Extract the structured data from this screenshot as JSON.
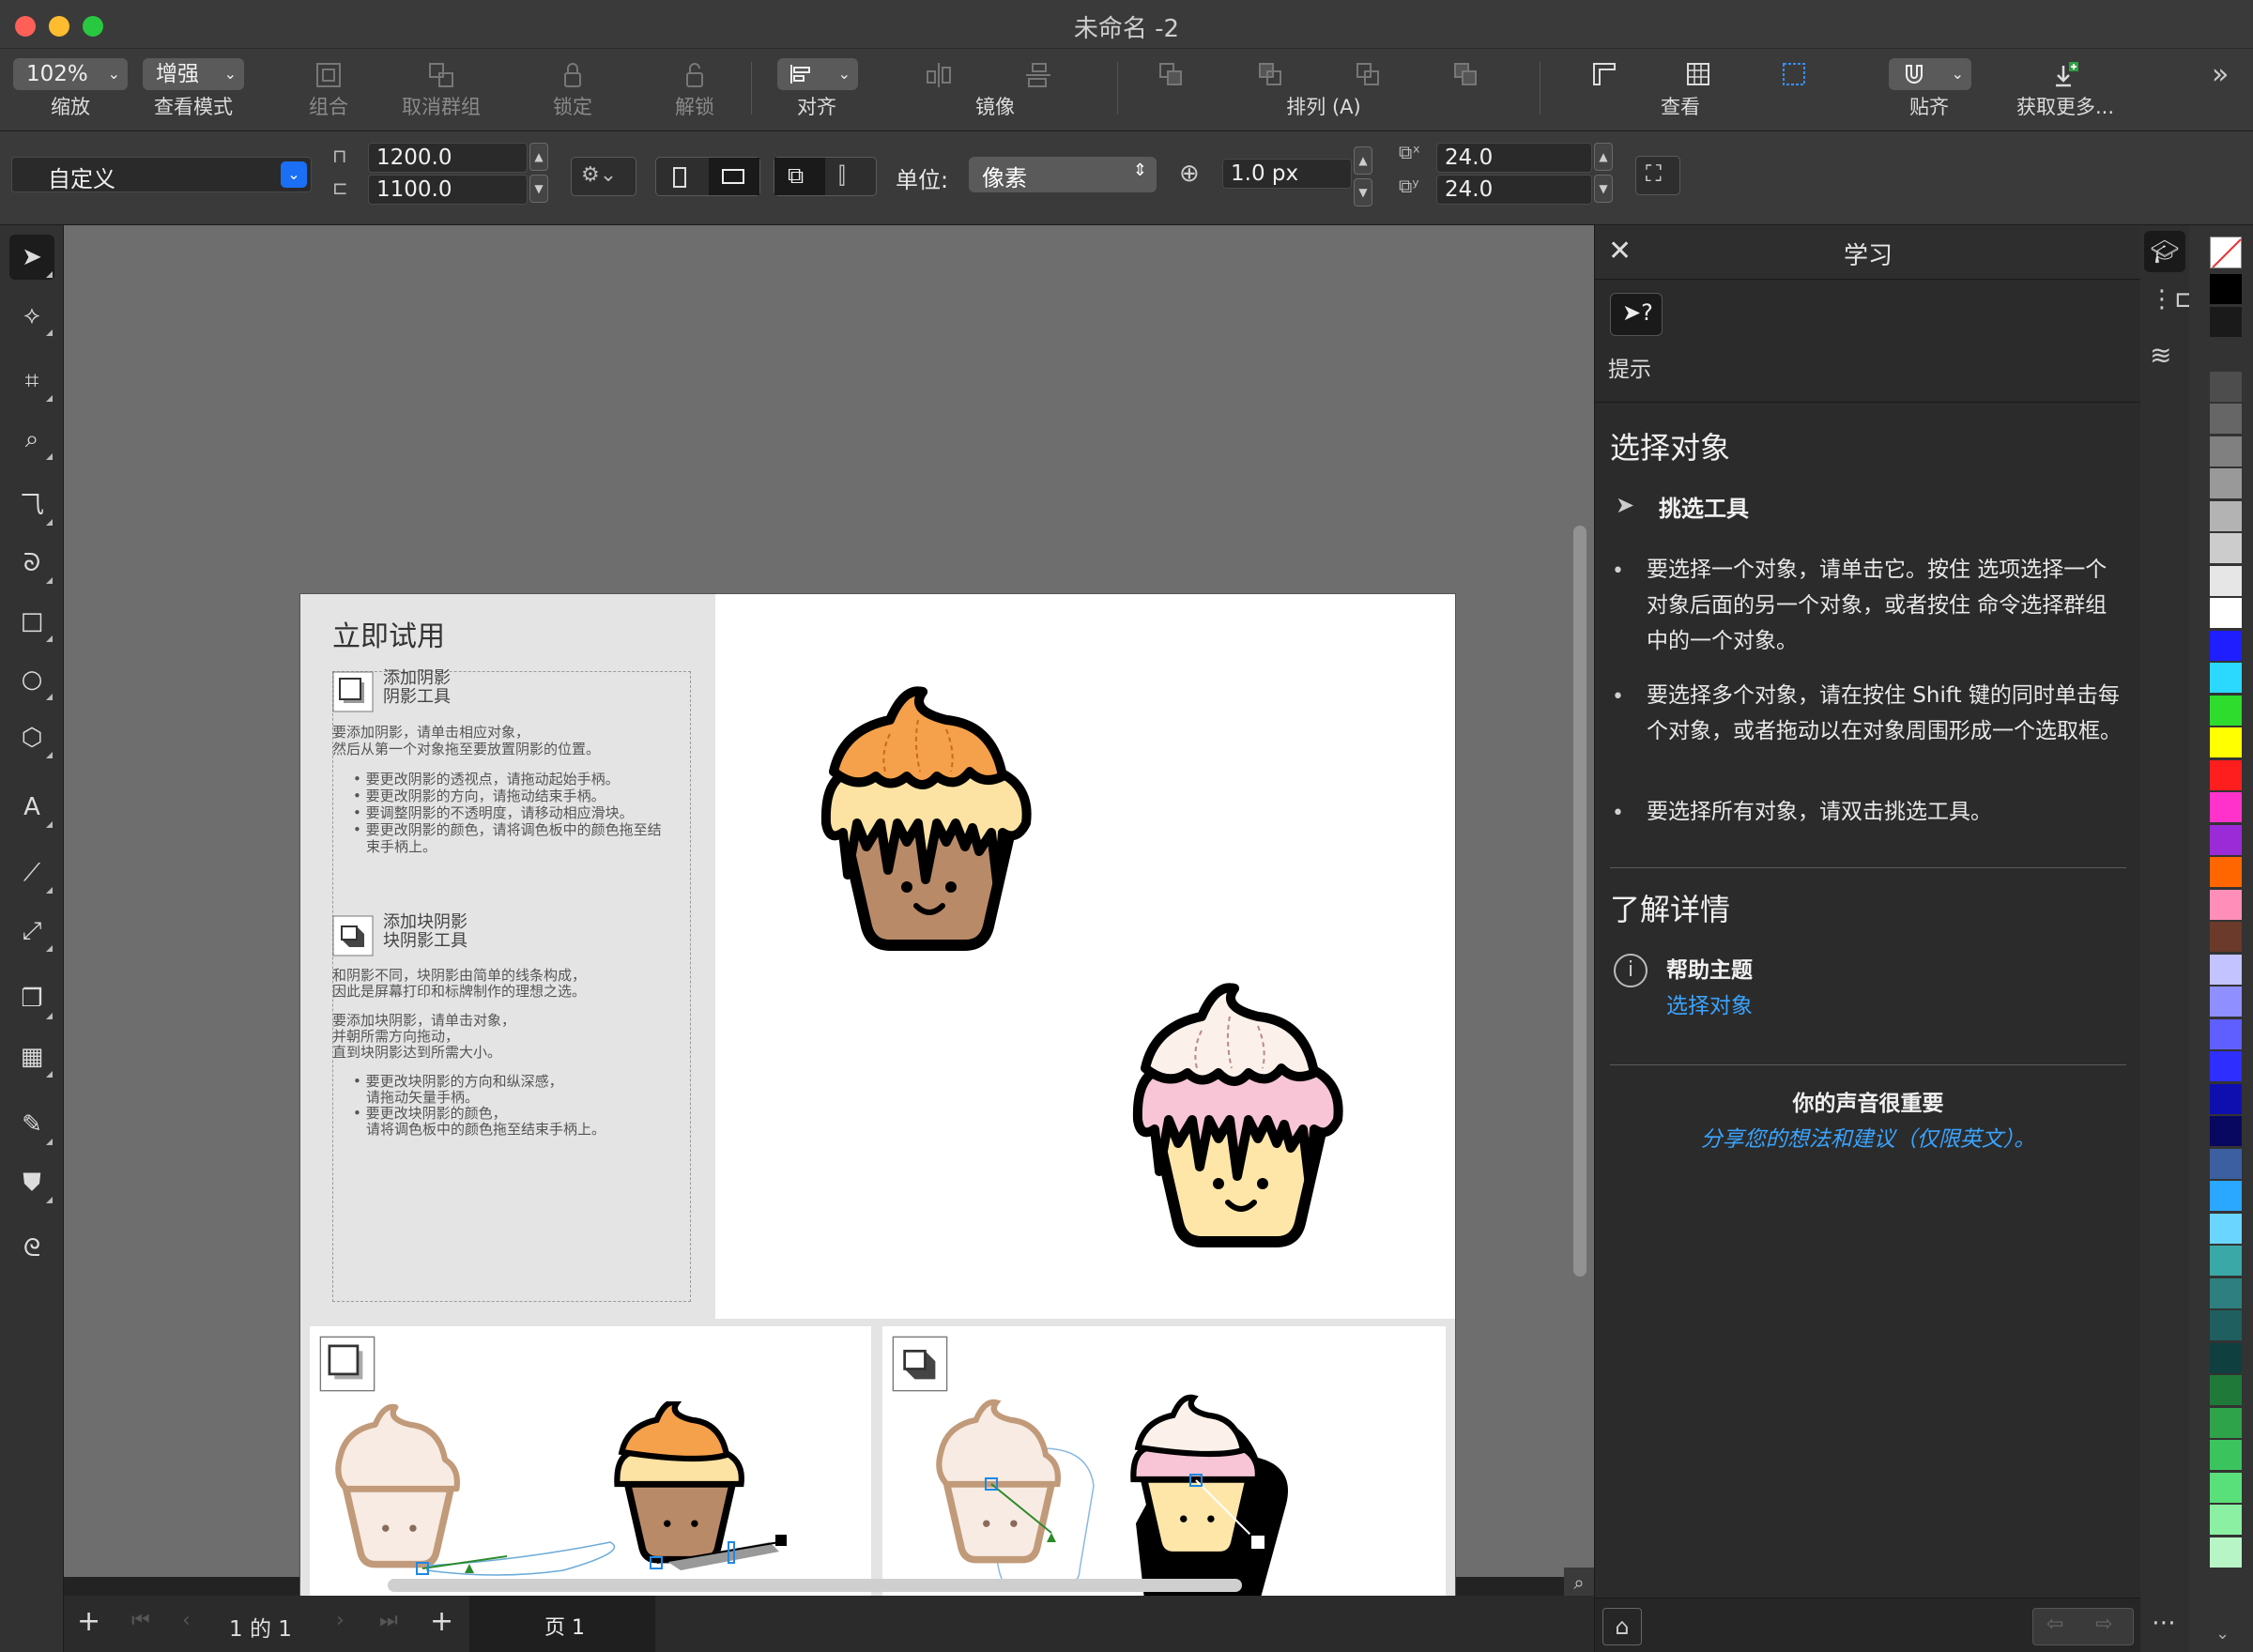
{
  "window": {
    "title": "未命名 -2"
  },
  "toolbar": {
    "zoom_value": "102%",
    "zoom_label": "缩放",
    "view_mode_value": "增强",
    "view_mode_label": "查看模式",
    "group_label": "组合",
    "ungroup_label": "取消群组",
    "lock_label": "锁定",
    "unlock_label": "解锁",
    "align_label": "对齐",
    "mirror_label": "镜像",
    "arrange_label": "排列 (A)",
    "view_label": "查看",
    "snap_label": "贴齐",
    "get_more_label": "获取更多..."
  },
  "propbar": {
    "preset": "自定义",
    "width": "1200.0",
    "height": "1100.0",
    "unit_label": "单位:",
    "unit_value": "像素",
    "nudge": "1.0 px",
    "dup_x": "24.0",
    "dup_y": "24.0"
  },
  "page_content": {
    "try_title": "立即试用",
    "shadow_title": "添加阴影",
    "shadow_sub": "阴影工具",
    "shadow_intro_1": "要添加阴影，请单击相应对象，",
    "shadow_intro_2": "然后从第一个对象拖至要放置阴影的位置。",
    "shadow_b1": "要更改阴影的透视点，请拖动起始手柄。",
    "shadow_b2": "要更改阴影的方向，请拖动结束手柄。",
    "shadow_b3": "要调整阴影的不透明度，请移动相应滑块。",
    "shadow_b4a": "要更改阴影的颜色，请将调色板中的颜色拖至结",
    "shadow_b4b": "束手柄上。",
    "block_title": "添加块阴影",
    "block_sub": "块阴影工具",
    "block_intro_1": "和阴影不同，块阴影由简单的线条构成，",
    "block_intro_2": "因此是屏幕打印和标牌制作的理想之选。",
    "block_how_1": "要添加块阴影，请单击对象，",
    "block_how_2": "并朝所需方向拖动，",
    "block_how_3": "直到块阴影达到所需大小。",
    "block_b1a": "要更改块阴影的方向和纵深感，",
    "block_b1b": "请拖动矢量手柄。",
    "block_b2a": "要更改块阴影的颜色，",
    "block_b2b": "请将调色板中的颜色拖至结束手柄上。"
  },
  "navbar": {
    "page_count": "1 的 1",
    "page_tab": "页 1"
  },
  "learn_panel": {
    "title": "学习",
    "hint_label": "提示",
    "section_title": "选择对象",
    "tool_name": "挑选工具",
    "bullet1": "要选择一个对象，请单击它。按住 选项选择一个对象后面的另一个对象，或者按住 命令选择群组中的一个对象。",
    "bullet2": "要选择多个对象，请在按住 Shift 键的同时单击每个对象，或者拖动以在对象周围形成一个选取框。",
    "bullet3": "要选择所有对象，请双击挑选工具。",
    "learn_more": "了解详情",
    "help_topics": "帮助主题",
    "help_link": "选择对象",
    "feedback_title": "你的声音很重要",
    "feedback_link": "分享您的想法和建议（仅限英文）。"
  },
  "palette_colors": [
    "#000000",
    "#1a1a1a",
    "#333333",
    "#4d4d4d",
    "#666666",
    "#808080",
    "#999999",
    "#b3b3b3",
    "#cccccc",
    "#e6e6e6",
    "#ffffff",
    "#1e1eff",
    "#2bd9ff",
    "#2ddc2d",
    "#ffff00",
    "#ff1e1e",
    "#ff33cc",
    "#9b2bd6",
    "#ff6600",
    "#ff8fb8",
    "#6b3a2a",
    "#c3c3ff",
    "#8f8fff",
    "#5f5fff",
    "#2e2eff",
    "#0f0fb0",
    "#080860",
    "#3b5fa0",
    "#2aa7ff",
    "#6ad6ff",
    "#3ba8a8",
    "#2e7f7f",
    "#1f5f5f",
    "#0f3f3f",
    "#1f7a3a",
    "#2fa34a",
    "#3bc45e",
    "#5ae07a",
    "#8cf0a3",
    "#b8f5c6"
  ]
}
